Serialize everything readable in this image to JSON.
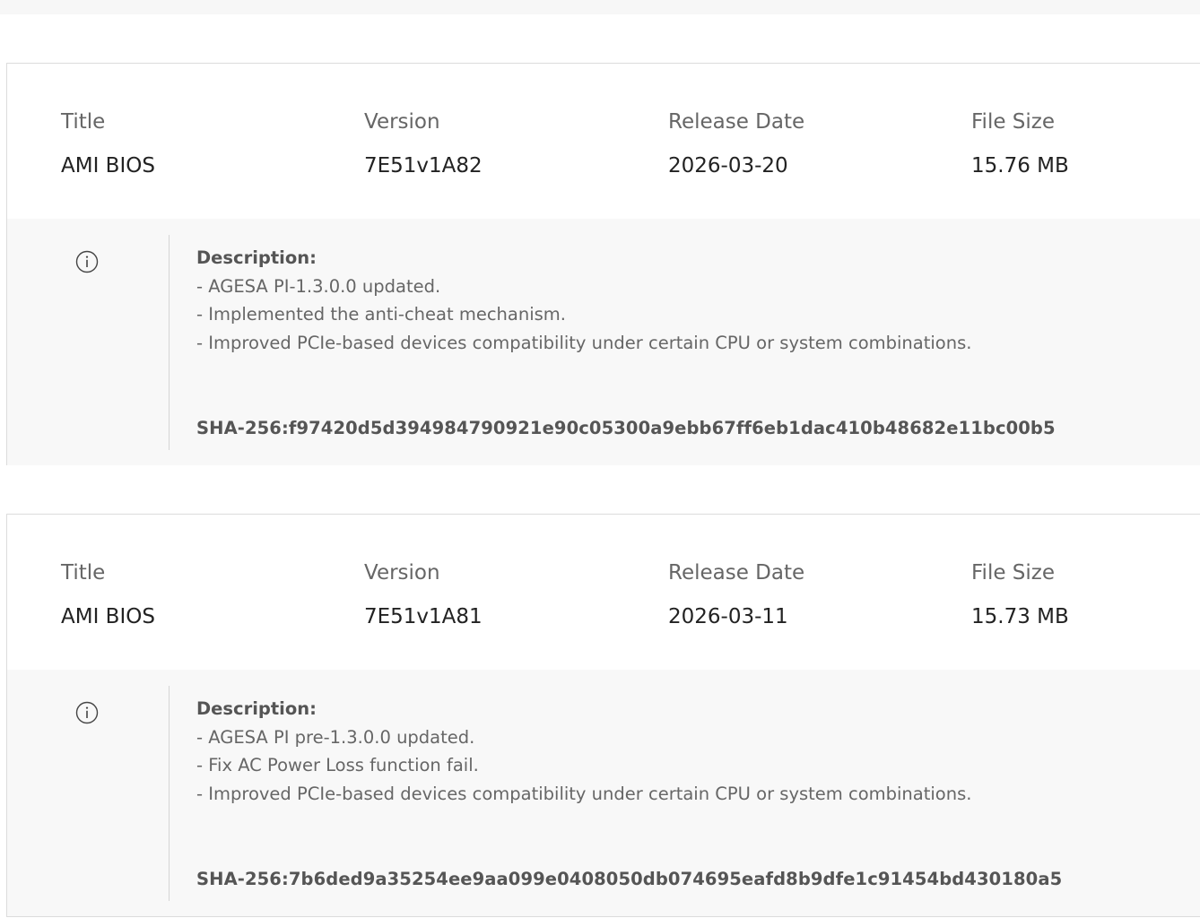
{
  "header": {
    "title_label": "Title",
    "version_label": "Version",
    "release_date_label": "Release Date",
    "file_size_label": "File Size"
  },
  "releases": [
    {
      "title": "AMI BIOS",
      "version": "7E51v1A82",
      "release_date": "2026-03-20",
      "file_size": "15.76 MB",
      "description_title": "Description:",
      "description_lines": [
        "- AGESA PI-1.3.0.0 updated.",
        "- Implemented the anti-cheat mechanism.",
        "- Improved PCIe-based devices compatibility under certain CPU or system combinations."
      ],
      "sha_label": "SHA-256:",
      "sha_value": "f97420d5d394984790921e90c05300a9ebb67ff6eb1dac410b48682e11bc00b5"
    },
    {
      "title": "AMI BIOS",
      "version": "7E51v1A81",
      "release_date": "2026-03-11",
      "file_size": "15.73 MB",
      "description_title": "Description:",
      "description_lines": [
        "- AGESA PI pre-1.3.0.0 updated.",
        "- Fix AC Power Loss function fail.",
        "- Improved PCIe-based devices compatibility under certain CPU or system combinations."
      ],
      "sha_label": "SHA-256:",
      "sha_value": "7b6ded9a35254ee9aa099e0408050db074695eafd8b9dfe1c91454bd430180a5"
    }
  ],
  "icons": {
    "info": "info-circle-icon"
  },
  "colors": {
    "label_text": "#666666",
    "value_text": "#222222",
    "description_bg": "#f8f8f8",
    "border": "#dcdcdc"
  }
}
